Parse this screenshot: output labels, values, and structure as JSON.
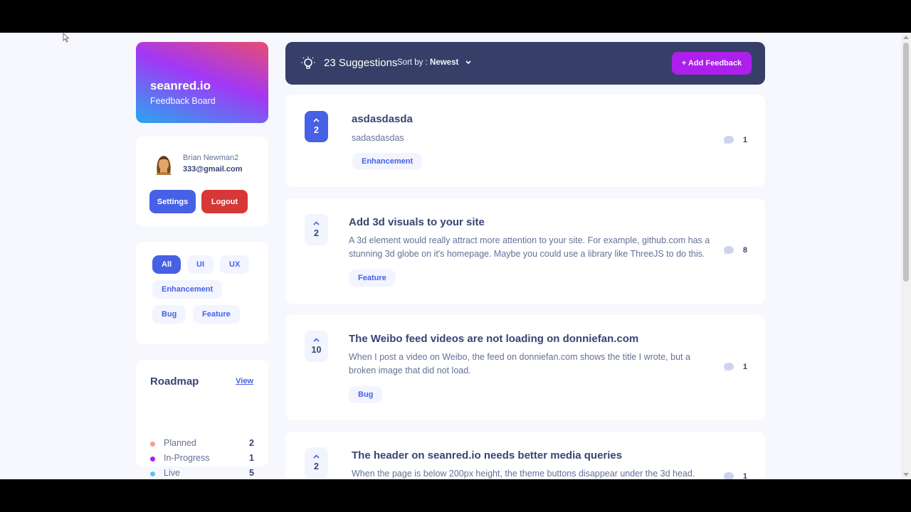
{
  "brand": {
    "name": "seanred.io",
    "subtitle": "Feedback Board"
  },
  "user": {
    "name": "Brian Newman2",
    "email": "333@gmail.com",
    "settings_label": "Settings",
    "logout_label": "Logout"
  },
  "filters": {
    "chips": [
      "All",
      "UI",
      "UX",
      "Enhancement",
      "Bug",
      "Feature"
    ],
    "active": "All"
  },
  "roadmap": {
    "title": "Roadmap",
    "view_label": "View",
    "items": [
      {
        "label": "Planned",
        "count": "2",
        "color": "#f49f85"
      },
      {
        "label": "In-Progress",
        "count": "1",
        "color": "#ad1fea"
      },
      {
        "label": "Live",
        "count": "5",
        "color": "#62bcfa"
      }
    ]
  },
  "header": {
    "suggestions": "23 Suggestions",
    "sort_prefix": "Sort by :",
    "sort_value": "Newest",
    "add_label": "+ Add Feedback"
  },
  "feedback": [
    {
      "votes": "2",
      "voted": true,
      "title": "asdasdasda",
      "desc": "sadasdasdas",
      "tag": "Enhancement",
      "comments": "1"
    },
    {
      "votes": "2",
      "voted": false,
      "title": "Add 3d visuals to your site",
      "desc": "A 3d element would really attract more attention to your site. For example, github.com has a stunning 3d globe on it's homepage. Maybe you could use a library like ThreeJS to do this.",
      "tag": "Feature",
      "comments": "8"
    },
    {
      "votes": "10",
      "voted": false,
      "title": "The Weibo feed videos are not loading on donniefan.com",
      "desc": "When I post a video on Weibo, the feed on donniefan.com shows the title I wrote, but a broken image that did not load.",
      "tag": "Bug",
      "comments": "1"
    },
    {
      "votes": "2",
      "voted": false,
      "title": "The header on seanred.io needs better media queries",
      "desc": "When the page is below 200px height, the theme buttons disappear under the 3d head.",
      "tag": "",
      "comments": "1"
    }
  ],
  "colors": {
    "accent": "#4661e6",
    "purple": "#ad1fea",
    "navy": "#373f68",
    "danger": "#d73737"
  }
}
